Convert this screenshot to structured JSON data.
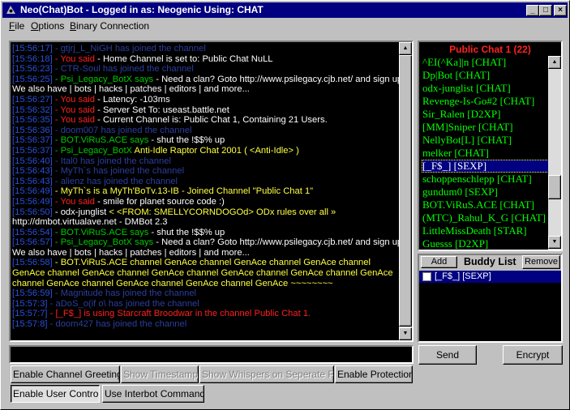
{
  "window": {
    "title": "Neo(Chat)Bot - Logged in as: Neogenic Using: CHAT",
    "controls": {
      "minimize": "_",
      "maximize": "□",
      "close": "×"
    }
  },
  "menu": [
    "File",
    "Options",
    "Binary Connection"
  ],
  "chat_log": [
    [
      [
        "ts",
        "[15:56:17]"
      ],
      [
        "gray",
        " - gtjrj_L_NiGH has joined the channel"
      ]
    ],
    [
      [
        "ts",
        "[15:56:18]"
      ],
      [
        "red",
        " - You said"
      ],
      [
        "white",
        " - Home Channel is set to: Public Chat NuLL"
      ]
    ],
    [
      [
        "ts",
        "[15:56:23]"
      ],
      [
        "gray",
        " - CTR-Soul has joined the channel"
      ]
    ],
    [
      [
        "ts",
        "[15:56:25]"
      ],
      [
        "green",
        " - Psi_Legacy_BotX says"
      ],
      [
        "white",
        " - Need a clan? Goto http://www.psilegacy.cjb.net/ and sign up."
      ]
    ],
    [
      [
        "white",
        "We also have | bots | hacks | patches | editors | and more..."
      ]
    ],
    [
      [
        "ts",
        "[15:56:27]"
      ],
      [
        "red",
        " - You said"
      ],
      [
        "white",
        " - Latency: -103ms"
      ]
    ],
    [
      [
        "ts",
        "[15:56:32]"
      ],
      [
        "red",
        " - You said"
      ],
      [
        "white",
        " - Server Set To: useast.battle.net"
      ]
    ],
    [
      [
        "ts",
        "[15:56:35]"
      ],
      [
        "red",
        " - You said"
      ],
      [
        "white",
        " - Current Channel is: Public Chat 1, Containing 21 Users."
      ]
    ],
    [
      [
        "ts",
        "[15:56:36]"
      ],
      [
        "gray",
        " - doom007 has joined the channel"
      ]
    ],
    [
      [
        "ts",
        "[15:56:37]"
      ],
      [
        "green",
        " - BOT.ViRuS.ACE says"
      ],
      [
        "white",
        " - shut the !$$% up"
      ]
    ],
    [
      [
        "ts",
        "[15:56:37]"
      ],
      [
        "green",
        " - Psi_Legacy_BotX"
      ],
      [
        "yellow",
        " Anti-Idle Raptor Chat 2001 ( <Anti-Idle> )"
      ]
    ],
    [
      [
        "ts",
        "[15:56:40]"
      ],
      [
        "gray",
        " - Ital0 has joined the channel"
      ]
    ],
    [
      [
        "ts",
        "[15:56:43]"
      ],
      [
        "gray",
        " - MyTh`s has joined the channel"
      ]
    ],
    [
      [
        "ts",
        "[15:56:43]"
      ],
      [
        "gray",
        " - alienz has joined the channel"
      ]
    ],
    [
      [
        "ts",
        "[15:56:49]"
      ],
      [
        "yellow",
        " - MyTh`s is a MyTh'BoTv.13-IB - Joined Channel \"Public Chat 1\""
      ]
    ],
    [
      [
        "ts",
        "[15:56:49]"
      ],
      [
        "red",
        " - You said"
      ],
      [
        "white",
        " - smile for planet source code :)"
      ]
    ],
    [
      [
        "ts",
        "[15:56:50]"
      ],
      [
        "white",
        " - odx-junglist"
      ],
      [
        "yellow",
        " < <FROM: SMELLYCORNDOGOd> ODx rules over all »"
      ]
    ],
    [
      [
        "white",
        "http://dmbot.virtualave.net - DMBot 2.3"
      ]
    ],
    [
      [
        "ts",
        "[15:56:54]"
      ],
      [
        "green",
        " - BOT.ViRuS.ACE says"
      ],
      [
        "white",
        " - shut the !$$% up"
      ]
    ],
    [
      [
        "ts",
        "[15:56:57]"
      ],
      [
        "green",
        " - Psi_Legacy_BotX says"
      ],
      [
        "white",
        " - Need a clan? Goto http://www.psilegacy.cjb.net/ and sign up."
      ]
    ],
    [
      [
        "white",
        "We also have | bots | hacks | patches | editors | and more..."
      ]
    ],
    [
      [
        "ts",
        "[15:56:58]"
      ],
      [
        "yellow",
        " - BOT.ViRuS.ACE channel GenAce channel GenAce channel GenAce  channel GenAce channel GenAce channel GenAce  channel GenAce channel GenAce channel GenAce  channel GenAce channel GenAce channel GenAce  channel GenAce ~~~~~~~~"
      ]
    ],
    [
      [
        "ts",
        "[15:56:59]"
      ],
      [
        "gray",
        " - Magnitude has joined the channel"
      ]
    ],
    [
      [
        "ts",
        "[15:57:3]"
      ],
      [
        "gray",
        " - aDoS_o(if o\\ has joined the channel"
      ]
    ],
    [
      [
        "ts",
        "[15:57:7]"
      ],
      [
        "red",
        " - [_F$_] is using Starcraft Broodwar in the channel Public Chat 1."
      ]
    ],
    [
      [
        "ts",
        "[15:57:8]"
      ],
      [
        "gray",
        " - doom427 has joined the channel"
      ]
    ]
  ],
  "channel": {
    "title": "Public Chat 1  (22)",
    "users": [
      "^EI(^Ka]|n [CHAT]",
      "Dp|Bot [CHAT]",
      "odx-junglist [CHAT]",
      "Revenge-Is-Go#2 [CHAT]",
      "Sir_Ralen [D2XP]",
      "[MM]Sniper [CHAT]",
      "NellyBot[L] [CHAT]",
      "melker [CHAT]",
      "[_F$_] [SEXP]",
      "schoppenschlepp [CHAT]",
      "gundum0 [SEXP]",
      "BOT.ViRuS.ACE [CHAT]",
      "(MTC)_Rahul_K_G [CHAT]",
      "LittleMissDeath [STAR]",
      "Guesss [D2XP]"
    ],
    "selected_index": 8
  },
  "buddy": {
    "add_label": "Add",
    "title": "Buddy List",
    "remove_label": "Remove",
    "items": [
      "[_F$_] [SEXP]"
    ]
  },
  "actions": {
    "send": "Send",
    "encrypt": "Encrypt"
  },
  "toggles": {
    "channel_greetings": "Enable Channel Greetings",
    "timestamps": "Show Timestamps",
    "whispers": "Show Whispers on Seperate Form",
    "protection": "Enable Protection",
    "user_control": "Enable User Control",
    "interbot": "Use Interbot Commands"
  },
  "colors": {
    "title_bar": "#000080",
    "background": "#000000",
    "user_text": "#00ff00",
    "highlight": "#ff2020"
  }
}
